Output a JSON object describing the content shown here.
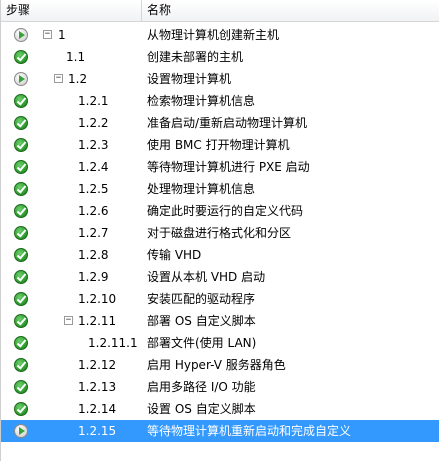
{
  "header": {
    "step": "步骤",
    "name": "名称"
  },
  "rows": [
    {
      "status": "running",
      "icon": "play-status-icon",
      "expander": "minus",
      "step": "1",
      "name": "从物理计算机创建新主机"
    },
    {
      "status": "done",
      "icon": "checkmark-status-icon",
      "step": "1.1",
      "name": "创建未部署的主机"
    },
    {
      "status": "running",
      "icon": "play-status-icon",
      "expander": "minus",
      "step": "1.2",
      "name": "设置物理计算机"
    },
    {
      "status": "done",
      "icon": "checkmark-status-icon",
      "step": "1.2.1",
      "name": "检索物理计算机信息"
    },
    {
      "status": "done",
      "icon": "checkmark-status-icon",
      "step": "1.2.2",
      "name": "准备启动/重新启动物理计算机"
    },
    {
      "status": "done",
      "icon": "checkmark-status-icon",
      "step": "1.2.3",
      "name": "使用 BMC 打开物理计算机"
    },
    {
      "status": "done",
      "icon": "checkmark-status-icon",
      "step": "1.2.4",
      "name": "等待物理计算机进行 PXE 启动"
    },
    {
      "status": "done",
      "icon": "checkmark-status-icon",
      "step": "1.2.5",
      "name": "处理物理计算机信息"
    },
    {
      "status": "done",
      "icon": "checkmark-status-icon",
      "step": "1.2.6",
      "name": "确定此时要运行的自定义代码"
    },
    {
      "status": "done",
      "icon": "checkmark-status-icon",
      "step": "1.2.7",
      "name": "对于磁盘进行格式化和分区"
    },
    {
      "status": "done",
      "icon": "checkmark-status-icon",
      "step": "1.2.8",
      "name": "传输 VHD"
    },
    {
      "status": "done",
      "icon": "checkmark-status-icon",
      "step": "1.2.9",
      "name": "设置从本机 VHD 启动"
    },
    {
      "status": "done",
      "icon": "checkmark-status-icon",
      "step": "1.2.10",
      "name": "安装匹配的驱动程序"
    },
    {
      "status": "done",
      "icon": "checkmark-status-icon",
      "expander": "minus",
      "step": "1.2.11",
      "name": "部署 OS 自定义脚本"
    },
    {
      "status": "done",
      "icon": "checkmark-status-icon",
      "step": "1.2.11.1",
      "name": "部署文件(使用 LAN)"
    },
    {
      "status": "done",
      "icon": "checkmark-status-icon",
      "step": "1.2.12",
      "name": "启用 Hyper-V 服务器角色"
    },
    {
      "status": "done",
      "icon": "checkmark-status-icon",
      "step": "1.2.13",
      "name": "启用多路径 I/O 功能"
    },
    {
      "status": "done",
      "icon": "checkmark-status-icon",
      "step": "1.2.14",
      "name": "设置 OS 自定义脚本"
    },
    {
      "status": "running",
      "icon": "play-status-icon",
      "step": "1.2.15",
      "name": "等待物理计算机重新启动和完成自定义",
      "selected": true
    }
  ]
}
